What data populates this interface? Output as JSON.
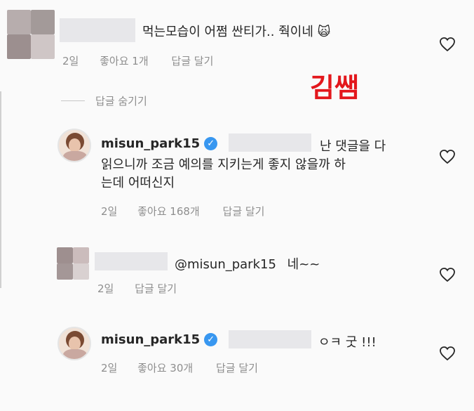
{
  "overlay_label": "김쌤",
  "comments": [
    {
      "text": "먹는모습이 어쩜 싼티가.. 줙이네",
      "emoji": "🙀",
      "time": "2일",
      "likes": "좋아요 1개",
      "reply": "답글 달기"
    }
  ],
  "hide_replies": "답글 숨기기",
  "replies": [
    {
      "username": "misun_park15",
      "line1": "난 댓글을 다",
      "line2": "읽으니까 조금 예의를 지키는게 좋지 않을까 하",
      "line3": "는데 어떠신지",
      "time": "2일",
      "likes": "좋아요 168개",
      "reply": "답글 달기"
    },
    {
      "mention": "@misun_park15",
      "text": "네~~",
      "time": "2일",
      "reply": "답글 달기"
    },
    {
      "username": "misun_park15",
      "text": "ㅇㅋ 굿 !!!",
      "time": "2일",
      "likes": "좋아요 30개",
      "reply": "답글 달기"
    }
  ],
  "colors": {
    "verified": "#3897f0",
    "label_red": "#e3171c",
    "meta_gray": "#8e8e8e"
  },
  "icons": [
    "heart-icon",
    "verified-badge-icon",
    "avatar"
  ]
}
